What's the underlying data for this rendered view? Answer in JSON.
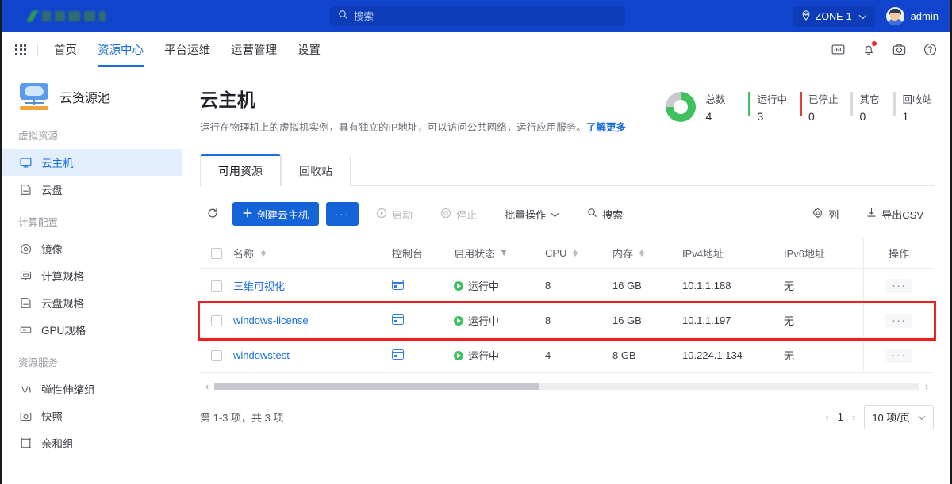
{
  "topbar": {
    "logo_alt": "company-logo",
    "search_placeholder": "搜索",
    "search_value": "",
    "zone_label": "ZONE-1",
    "user_name": "admin"
  },
  "nav": {
    "items": [
      {
        "label": "首页",
        "active": false
      },
      {
        "label": "资源中心",
        "active": true
      },
      {
        "label": "平台运维",
        "active": false
      },
      {
        "label": "运营管理",
        "active": false
      },
      {
        "label": "设置",
        "active": false
      }
    ],
    "icons": [
      "monitor-icon",
      "bell-icon",
      "camera-icon",
      "help-icon"
    ]
  },
  "sidebar": {
    "title": "云资源池",
    "groups": [
      {
        "label": "虚拟资源",
        "items": [
          {
            "label": "云主机",
            "icon": "display-icon",
            "active": true
          },
          {
            "label": "云盘",
            "icon": "disk-icon",
            "active": false
          }
        ]
      },
      {
        "label": "计算配置",
        "items": [
          {
            "label": "镜像",
            "icon": "target-icon",
            "active": false
          },
          {
            "label": "计算规格",
            "icon": "cpu-icon",
            "active": false
          },
          {
            "label": "云盘规格",
            "icon": "disk-icon",
            "active": false
          },
          {
            "label": "GPU规格",
            "icon": "gpu-icon",
            "active": false
          }
        ]
      },
      {
        "label": "资源服务",
        "items": [
          {
            "label": "弹性伸缩组",
            "icon": "scaling-icon",
            "active": false
          },
          {
            "label": "快照",
            "icon": "camera-icon",
            "active": false
          },
          {
            "label": "亲和组",
            "icon": "group-icon",
            "active": false
          }
        ]
      }
    ]
  },
  "page": {
    "title": "云主机",
    "description": "运行在物理机上的虚拟机实例，具有独立的IP地址，可以访问公共网络，运行应用服务。",
    "learn_more": "了解更多"
  },
  "stats": [
    {
      "label": "总数",
      "value": "4",
      "color": "#3fc15f",
      "type": "donut"
    },
    {
      "label": "运行中",
      "value": "3",
      "color": "#3fc15f",
      "type": "bar"
    },
    {
      "label": "已停止",
      "value": "0",
      "color": "#e23d3d",
      "type": "bar"
    },
    {
      "label": "其它",
      "value": "0",
      "color": "#d8d8de",
      "type": "bar"
    },
    {
      "label": "回收站",
      "value": "1",
      "color": "#d8d8de",
      "type": "bar"
    }
  ],
  "tabs": [
    {
      "label": "可用资源",
      "active": true
    },
    {
      "label": "回收站",
      "active": false
    }
  ],
  "toolbar": {
    "refresh_icon": "refresh-icon",
    "create_label": "创建云主机",
    "more_label": "···",
    "start_label": "启动",
    "stop_label": "停止",
    "batch_label": "批量操作",
    "search_label": "搜索",
    "columns_label": "列",
    "export_label": "导出CSV"
  },
  "table": {
    "headers": [
      {
        "label": "",
        "key": "checkbox"
      },
      {
        "label": "名称",
        "key": "name",
        "sortable": true
      },
      {
        "label": "控制台",
        "key": "console"
      },
      {
        "label": "启用状态",
        "key": "status",
        "filterable": true
      },
      {
        "label": "CPU",
        "key": "cpu",
        "sortable": true
      },
      {
        "label": "内存",
        "key": "memory",
        "sortable": true
      },
      {
        "label": "IPv4地址",
        "key": "ipv4"
      },
      {
        "label": "IPv6地址",
        "key": "ipv6"
      },
      {
        "label": "操作",
        "key": "action"
      }
    ],
    "rows": [
      {
        "name": "三维可视化",
        "console": "console-icon",
        "status": "运行中",
        "cpu": "8",
        "memory": "16 GB",
        "ipv4": "10.1.1.188",
        "ipv6": "无",
        "action": "···",
        "highlighted": false
      },
      {
        "name": "windows-license",
        "console": "console-icon",
        "status": "运行中",
        "cpu": "8",
        "memory": "16 GB",
        "ipv4": "10.1.1.197",
        "ipv6": "无",
        "action": "···",
        "highlighted": true
      },
      {
        "name": "windowstest",
        "console": "console-icon",
        "status": "运行中",
        "cpu": "4",
        "memory": "8 GB",
        "ipv4": "10.224.1.134",
        "ipv6": "无",
        "action": "···",
        "highlighted": false
      }
    ]
  },
  "footer": {
    "summary": "第 1-3 项，共 3 项",
    "prev": "‹",
    "page": "1",
    "next": "›",
    "page_size": "10 项/页"
  },
  "colors": {
    "brand_blue": "#1144cc",
    "accent_blue": "#1a6fe0",
    "primary_button": "#1463d8",
    "success_green": "#3fc15f",
    "danger_red": "#e23d3d",
    "highlight_outline": "#f01f1f"
  }
}
